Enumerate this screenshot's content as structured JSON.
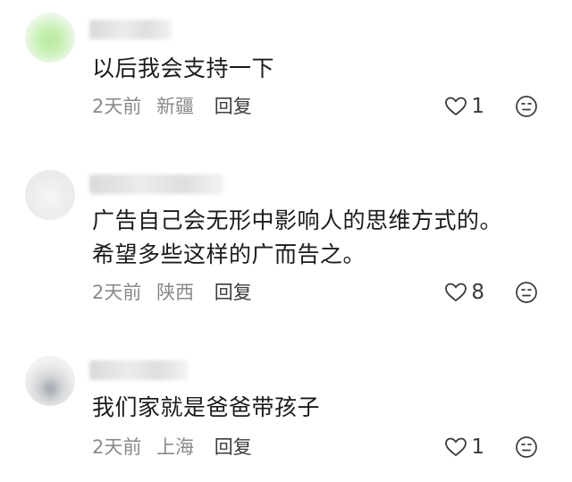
{
  "comments": [
    {
      "text_lines": [
        "以后我会支持一下"
      ],
      "time": "2天前",
      "location": "新疆",
      "reply_label": "回复",
      "likes": "1",
      "avatar_color": "#a7e09a"
    },
    {
      "text_lines": [
        "广告自己会无形中影响人的思维方式的。",
        "希望多些这样的广而告之。"
      ],
      "time": "2天前",
      "location": "陕西",
      "reply_label": "回复",
      "likes": "8",
      "avatar_color": "#e8e8e8"
    },
    {
      "text_lines": [
        "我们家就是爸爸带孩子"
      ],
      "time": "2天前",
      "location": "上海",
      "reply_label": "回复",
      "likes": "1",
      "avatar_color": "#ededed"
    }
  ],
  "icons": {
    "like": "heart-outline-icon",
    "reaction": "neutral-face-icon"
  }
}
